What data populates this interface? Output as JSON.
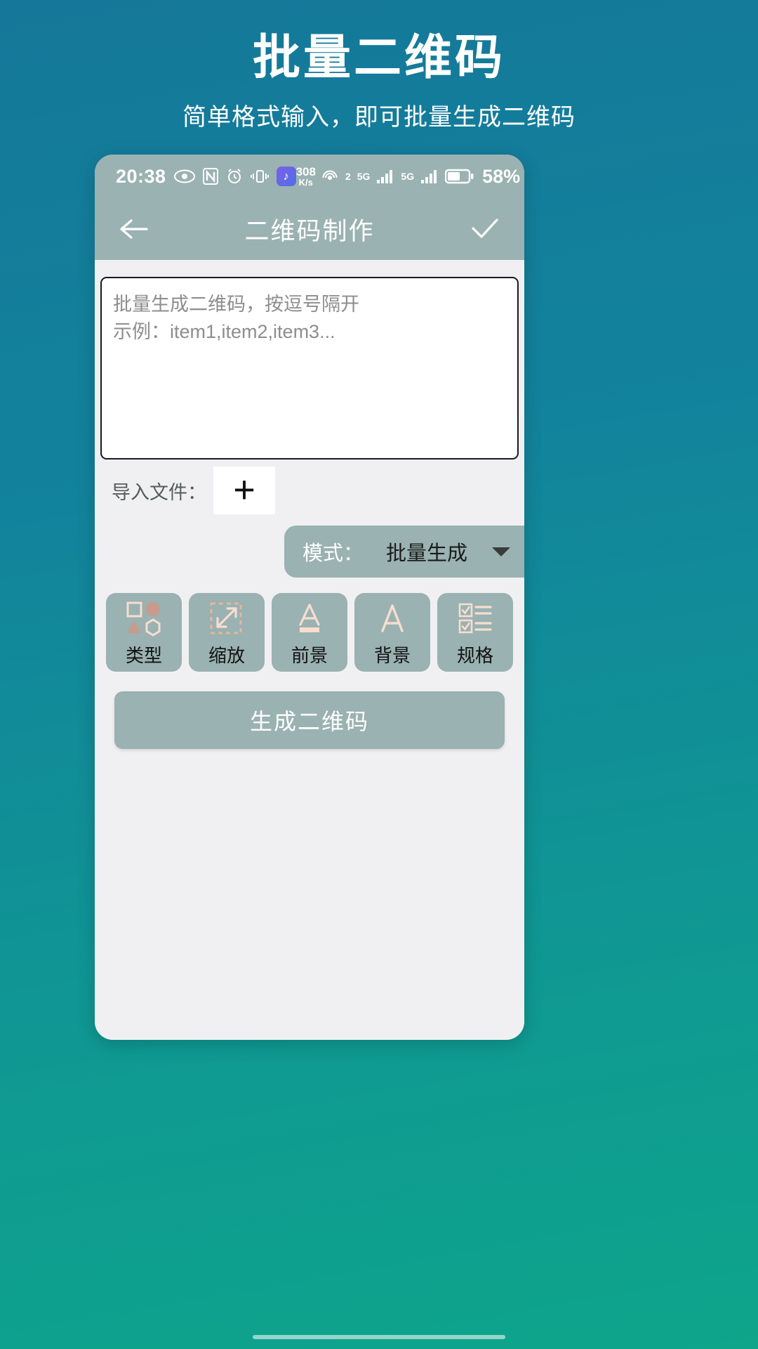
{
  "promo": {
    "title": "批量二维码",
    "subtitle": "简单格式输入，即可批量生成二维码"
  },
  "theme": {
    "background_start": "#15789a",
    "background_end": "#0ea58b",
    "chrome": "#9ab2b1",
    "screen_bg": "#f0f0f2",
    "icon_accent": "#f7ded0"
  },
  "statusbar": {
    "time": "20:38",
    "icons_left": [
      "eye-icon",
      "nfc-icon",
      "alarm-icon",
      "vibrate-icon",
      "music-app-icon"
    ],
    "netspeed_value": "308",
    "netspeed_unit": "K/s",
    "hotspot_count": "2",
    "sim1_label": "5G",
    "sim2_label": "5G",
    "battery_percent": "58%"
  },
  "appbar": {
    "back_icon": "back-arrow-icon",
    "title": "二维码制作",
    "confirm_icon": "check-icon"
  },
  "editor": {
    "placeholder_line1": "批量生成二维码，按逗号隔开",
    "placeholder_line2": "示例：item1,item2,item3...",
    "value": ""
  },
  "import": {
    "label": "导入文件：",
    "add_glyph": "+"
  },
  "mode": {
    "label": "模式：",
    "value": "批量生成",
    "options": [
      "批量生成"
    ]
  },
  "tools": [
    {
      "label": "类型",
      "icon": "shapes-icon"
    },
    {
      "label": "缩放",
      "icon": "resize-icon"
    },
    {
      "label": "前景",
      "icon": "foreground-text-icon"
    },
    {
      "label": "背景",
      "icon": "background-text-icon"
    },
    {
      "label": "规格",
      "icon": "checklist-icon"
    }
  ],
  "actions": {
    "generate_label": "生成二维码"
  }
}
